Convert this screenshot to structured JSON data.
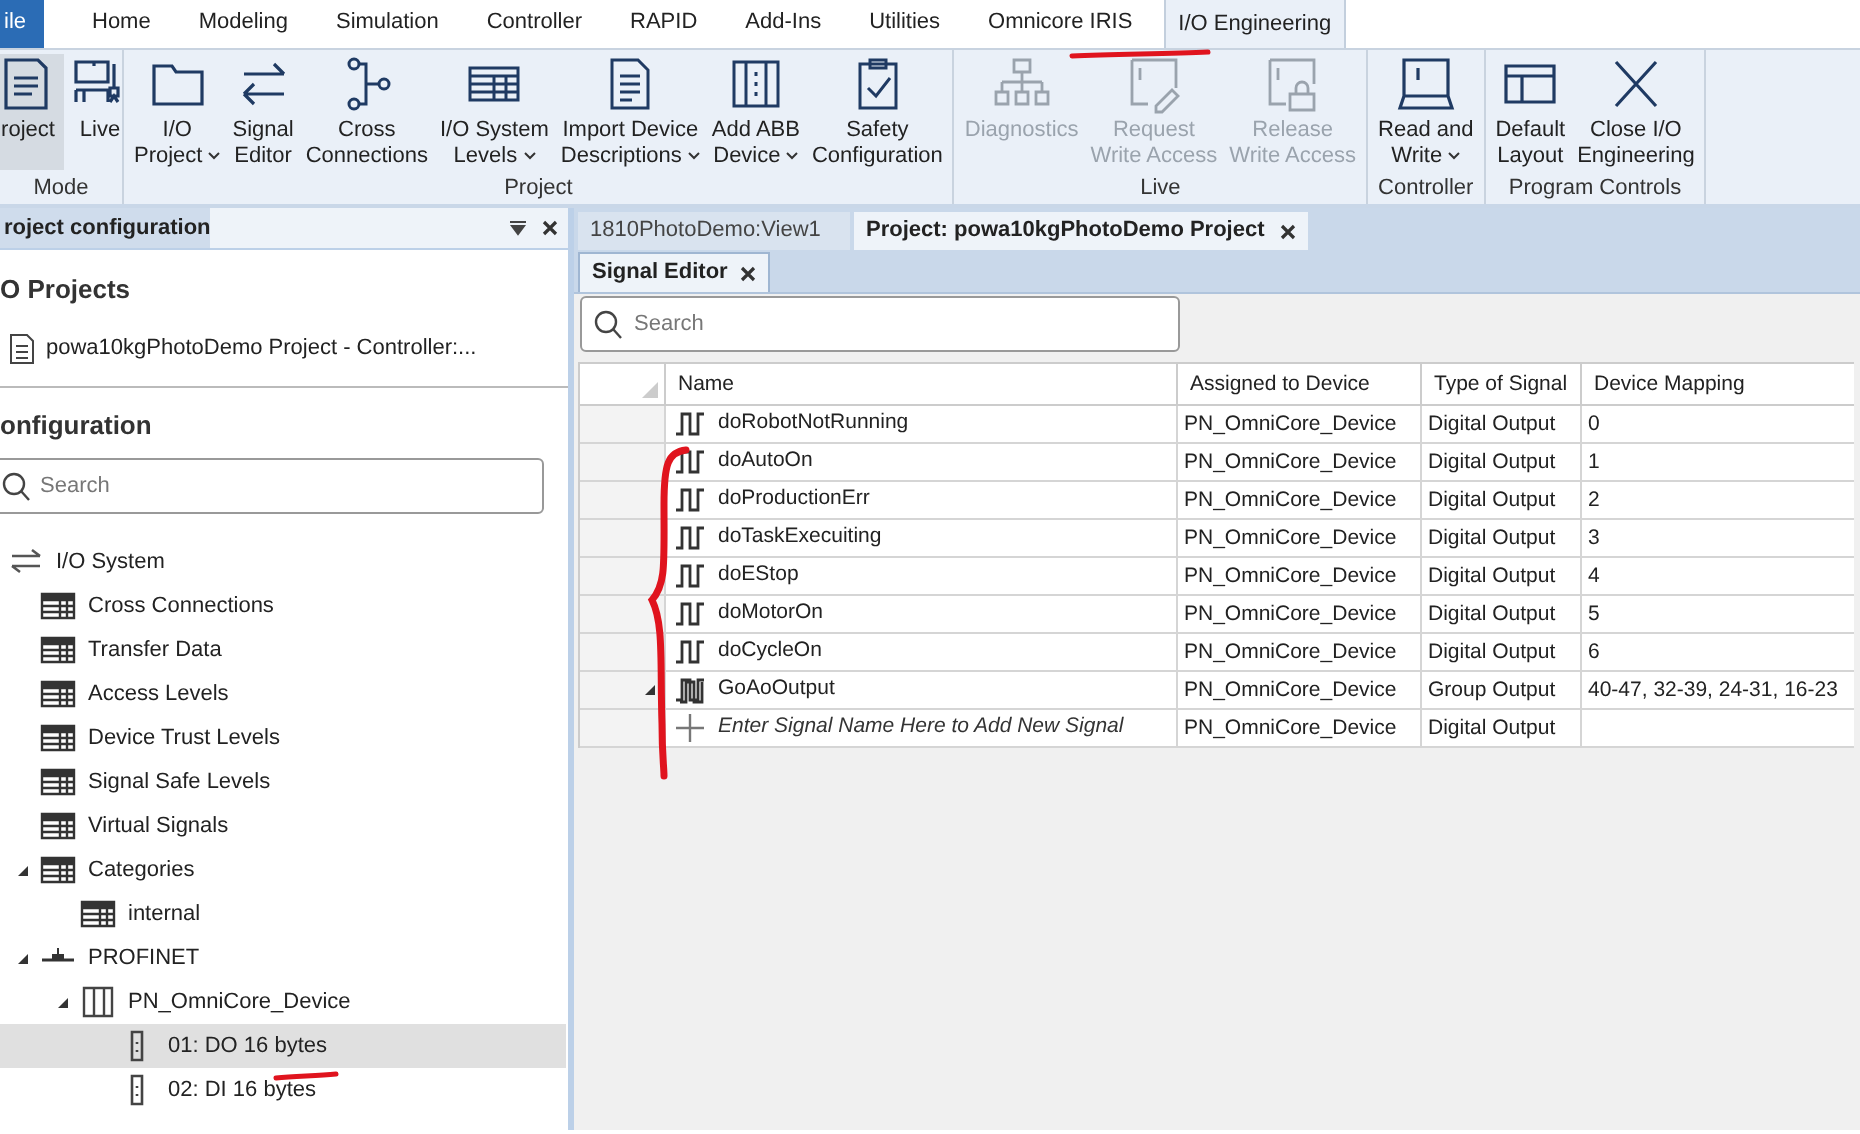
{
  "menu_tabs": [
    {
      "label": "ile",
      "kind": "file",
      "selected": false
    },
    {
      "label": "Home",
      "selected": false
    },
    {
      "label": "Modeling",
      "selected": false
    },
    {
      "label": "Simulation",
      "selected": false
    },
    {
      "label": "Controller",
      "selected": false
    },
    {
      "label": "RAPID",
      "selected": false
    },
    {
      "label": "Add-Ins",
      "selected": false
    },
    {
      "label": "Utilities",
      "selected": false
    },
    {
      "label": "Omnicore IRIS",
      "selected": false
    },
    {
      "label": "I/O Engineering",
      "selected": true
    }
  ],
  "ribbon": [
    {
      "label": "Mode",
      "buttons": [
        {
          "label": "roject",
          "selected": true,
          "disabled": false
        },
        {
          "label": "Live",
          "selected": false,
          "disabled": false
        }
      ]
    },
    {
      "label": "Project",
      "buttons": [
        {
          "label": "I/O\nProject",
          "dropdown": true,
          "selected": false,
          "disabled": false
        },
        {
          "label": "Signal\nEditor",
          "selected": false,
          "disabled": false
        },
        {
          "label": "Cross\nConnections",
          "selected": false,
          "disabled": false
        },
        {
          "label": "I/O System\nLevels",
          "dropdown": true,
          "selected": false,
          "disabled": false
        },
        {
          "label": "Import Device\nDescriptions",
          "dropdown": true,
          "selected": false,
          "disabled": false
        },
        {
          "label": "Add ABB\nDevice",
          "dropdown": true,
          "selected": false,
          "disabled": false
        },
        {
          "label": "Safety\nConfiguration",
          "selected": false,
          "disabled": false
        }
      ]
    },
    {
      "label": "Live",
      "buttons": [
        {
          "label": "Diagnostics",
          "selected": false,
          "disabled": true
        },
        {
          "label": "Request\nWrite Access",
          "selected": false,
          "disabled": true
        },
        {
          "label": "Release\nWrite Access",
          "selected": false,
          "disabled": true
        }
      ]
    },
    {
      "label": "Controller",
      "buttons": [
        {
          "label": "Read and\nWrite",
          "dropdown": true,
          "selected": false,
          "disabled": false
        }
      ]
    },
    {
      "label": "Program Controls",
      "buttons": [
        {
          "label": "Default\nLayout",
          "selected": false,
          "disabled": false
        },
        {
          "label": "Close I/O\nEngineering",
          "selected": false,
          "disabled": false
        }
      ]
    }
  ],
  "left_panel": {
    "title": "roject configuration",
    "projects_heading": "O Projects",
    "project_item": "powa10kgPhotoDemo Project - Controller:...",
    "configuration_heading": "onfiguration",
    "search": {
      "placeholder": "Search"
    },
    "tree": [
      {
        "label": "I/O System",
        "kind": "arrows",
        "selected": false,
        "children": [
          {
            "label": "Cross Connections",
            "kind": "table",
            "selected": false
          },
          {
            "label": "Transfer Data",
            "kind": "table",
            "selected": false
          },
          {
            "label": "Access Levels",
            "kind": "table",
            "selected": false
          },
          {
            "label": "Device Trust Levels",
            "kind": "table",
            "selected": false
          },
          {
            "label": "Signal Safe Levels",
            "kind": "table",
            "selected": false
          },
          {
            "label": "Virtual Signals",
            "kind": "table",
            "selected": false
          },
          {
            "label": "Categories",
            "kind": "table",
            "expanded": true,
            "selected": false,
            "children": [
              {
                "label": "internal",
                "kind": "table",
                "selected": false
              }
            ]
          },
          {
            "label": "PROFINET",
            "kind": "network",
            "expanded": true,
            "selected": false,
            "children": [
              {
                "label": "PN_OmniCore_Device",
                "kind": "device",
                "expanded": true,
                "selected": false,
                "children": [
                  {
                    "label": "01: DO 16 bytes",
                    "kind": "module",
                    "selected": true
                  },
                  {
                    "label": "02: DI 16 bytes",
                    "kind": "module",
                    "selected": false
                  }
                ]
              }
            ]
          }
        ]
      }
    ]
  },
  "document_tabs": [
    {
      "label": "1810PhotoDemo:View1",
      "selected": false
    },
    {
      "label": "Project: powa10kgPhotoDemo Project",
      "selected": true
    }
  ],
  "editor_tab": {
    "label": "Signal Editor"
  },
  "signal_search": {
    "placeholder": "Search"
  },
  "table": {
    "columns": [
      "Name",
      "Assigned to Device",
      "Type of Signal",
      "Device Mapping"
    ],
    "rows": [
      {
        "kind": "digital",
        "name": "doRobotNotRunning",
        "device": "PN_OmniCore_Device",
        "type": "Digital Output",
        "mapping": "0"
      },
      {
        "kind": "digital",
        "name": "doAutoOn",
        "device": "PN_OmniCore_Device",
        "type": "Digital Output",
        "mapping": "1"
      },
      {
        "kind": "digital",
        "name": "doProductionErr",
        "device": "PN_OmniCore_Device",
        "type": "Digital Output",
        "mapping": "2"
      },
      {
        "kind": "digital",
        "name": "doTaskExecuiting",
        "device": "PN_OmniCore_Device",
        "type": "Digital Output",
        "mapping": "3"
      },
      {
        "kind": "digital",
        "name": "doEStop",
        "device": "PN_OmniCore_Device",
        "type": "Digital Output",
        "mapping": "4"
      },
      {
        "kind": "digital",
        "name": "doMotorOn",
        "device": "PN_OmniCore_Device",
        "type": "Digital Output",
        "mapping": "5"
      },
      {
        "kind": "digital",
        "name": "doCycleOn",
        "device": "PN_OmniCore_Device",
        "type": "Digital Output",
        "mapping": "6"
      },
      {
        "kind": "group",
        "name": "GoAoOutput",
        "device": "PN_OmniCore_Device",
        "type": "Group Output",
        "mapping": "40-47, 32-39, 24-31, 16-23"
      },
      {
        "kind": "new",
        "placeholder": "Enter Signal Name Here to Add New Signal",
        "device": "PN_OmniCore_Device",
        "type": "Digital Output"
      }
    ]
  }
}
